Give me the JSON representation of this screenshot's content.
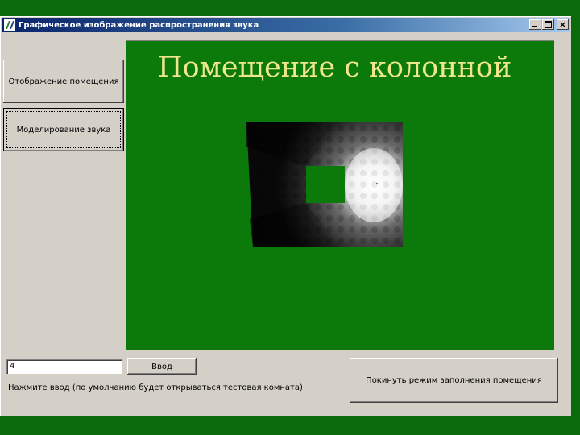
{
  "window": {
    "title": "Графическое изображение распространения звука",
    "controls": {
      "minimize": "_",
      "maximize": "□",
      "close": "×"
    }
  },
  "sidebar": {
    "buttons": [
      {
        "label": "Отображение помещения"
      },
      {
        "label": "Моделирование звука"
      }
    ]
  },
  "canvas": {
    "title": "Помещение с колонной",
    "background_color": "#0b7a0b",
    "title_color": "#f0e68c"
  },
  "footer": {
    "input_value": "4",
    "enter_label": "Ввод",
    "exit_label": "Покинуть режим заполнения помещения",
    "hint": "Нажмите ввод (по умолчанию будет открываться тестовая комната)"
  }
}
